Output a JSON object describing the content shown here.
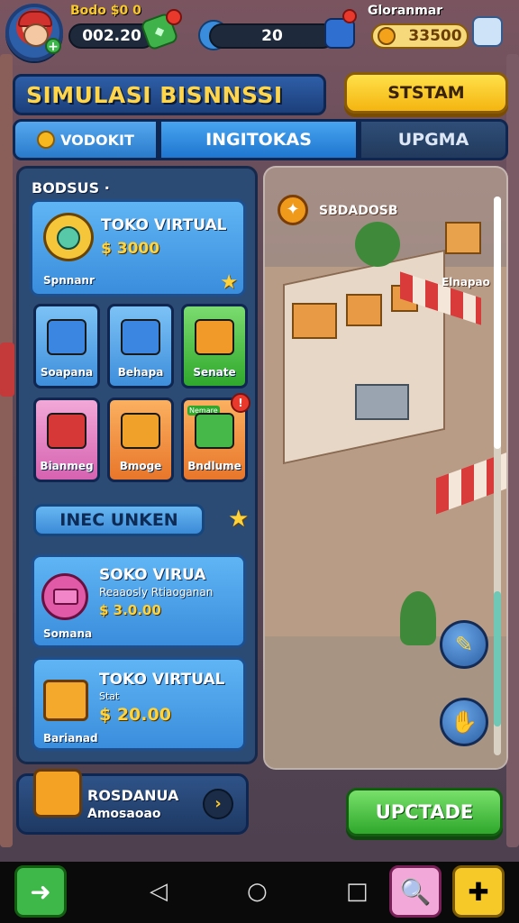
{
  "topbar": {
    "stat1_label": "Bodo $0 0",
    "stat1_value": "002.20",
    "stat2_value": "20",
    "stat3_label": "Gloranmar",
    "stat3_value": "33500"
  },
  "header": {
    "title": "SIMULASI BISNNSSI",
    "start_button": "STSTAM"
  },
  "tabs": [
    {
      "label": "VODOKIT"
    },
    {
      "label": "INGITOKAS"
    },
    {
      "label": "UPGMA"
    }
  ],
  "left_panel": {
    "header": "BODSUS ·",
    "featured": {
      "title": "TOKO VIRTUAL",
      "price": "$ 3000",
      "caption": "Spnnanr"
    },
    "tiles": [
      {
        "label": "Soapana",
        "color": "#5fa8ef"
      },
      {
        "label": "Behapa",
        "color": "#5fa8ef"
      },
      {
        "label": "Senate",
        "color": "#46b84a"
      },
      {
        "label": "Bianmeg",
        "color": "#e98ac6"
      },
      {
        "label": "Bmoge",
        "color": "#f08a2c"
      },
      {
        "label": "Bndlume",
        "color": "#f08a2c"
      }
    ],
    "tile_badge": "Nemare",
    "unlock_label": "INEC UNKEN",
    "items": [
      {
        "title": "SOKO VIRUA",
        "subtitle": "Reaaosly Rtiaoganan",
        "price": "$ 3.0.00",
        "caption": "Somana"
      },
      {
        "title": "TOKO VIRTUAL",
        "subtitle": "Stat",
        "price": "$ 20.00",
        "caption": "Barianad"
      }
    ]
  },
  "right_panel": {
    "label": "SBDADOSB",
    "sublabel": "Elnapao"
  },
  "bottom": {
    "business_title": "ROSDANUA",
    "business_sub": "Amosaoao",
    "upgrade_button": "UPCTADE"
  },
  "colors": {
    "accent_blue": "#3a8ddc",
    "accent_gold": "#ffd33a",
    "accent_green": "#2fa82c"
  }
}
